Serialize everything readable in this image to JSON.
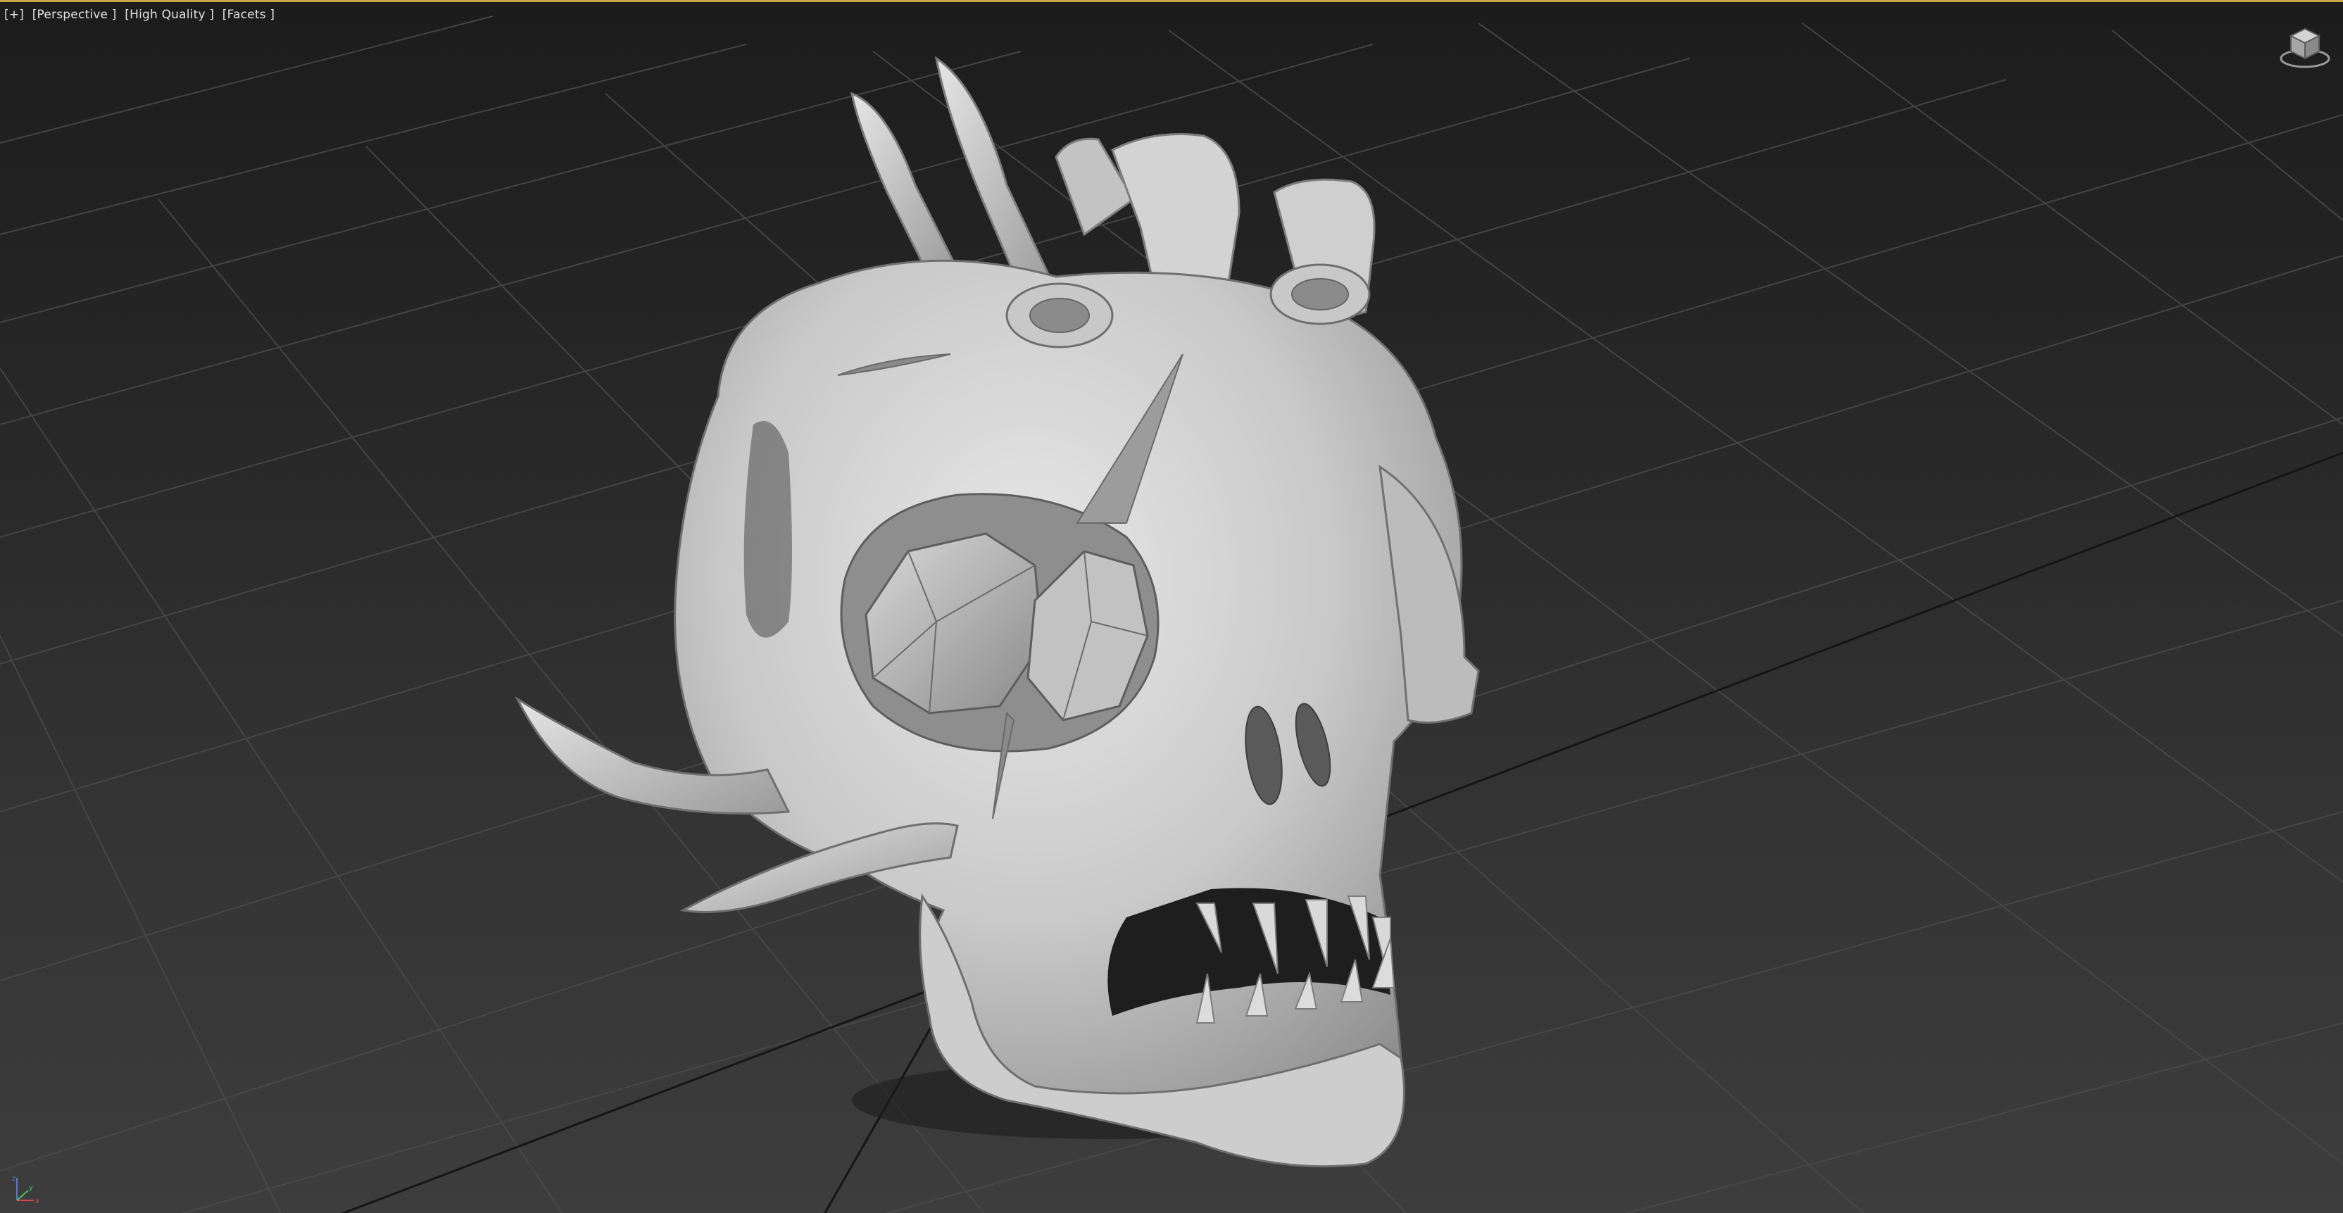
{
  "viewport": {
    "label_plus": "[+]",
    "label_view": "[Perspective ]",
    "label_shading": "[High Quality ]",
    "label_style": "[Facets ]",
    "accent_color": "#c7a64a"
  },
  "icons": {
    "viewcube": "viewcube-icon",
    "axis": "axis-tripod-icon"
  },
  "axis_labels": {
    "x": "x",
    "y": "y",
    "z": "z"
  }
}
